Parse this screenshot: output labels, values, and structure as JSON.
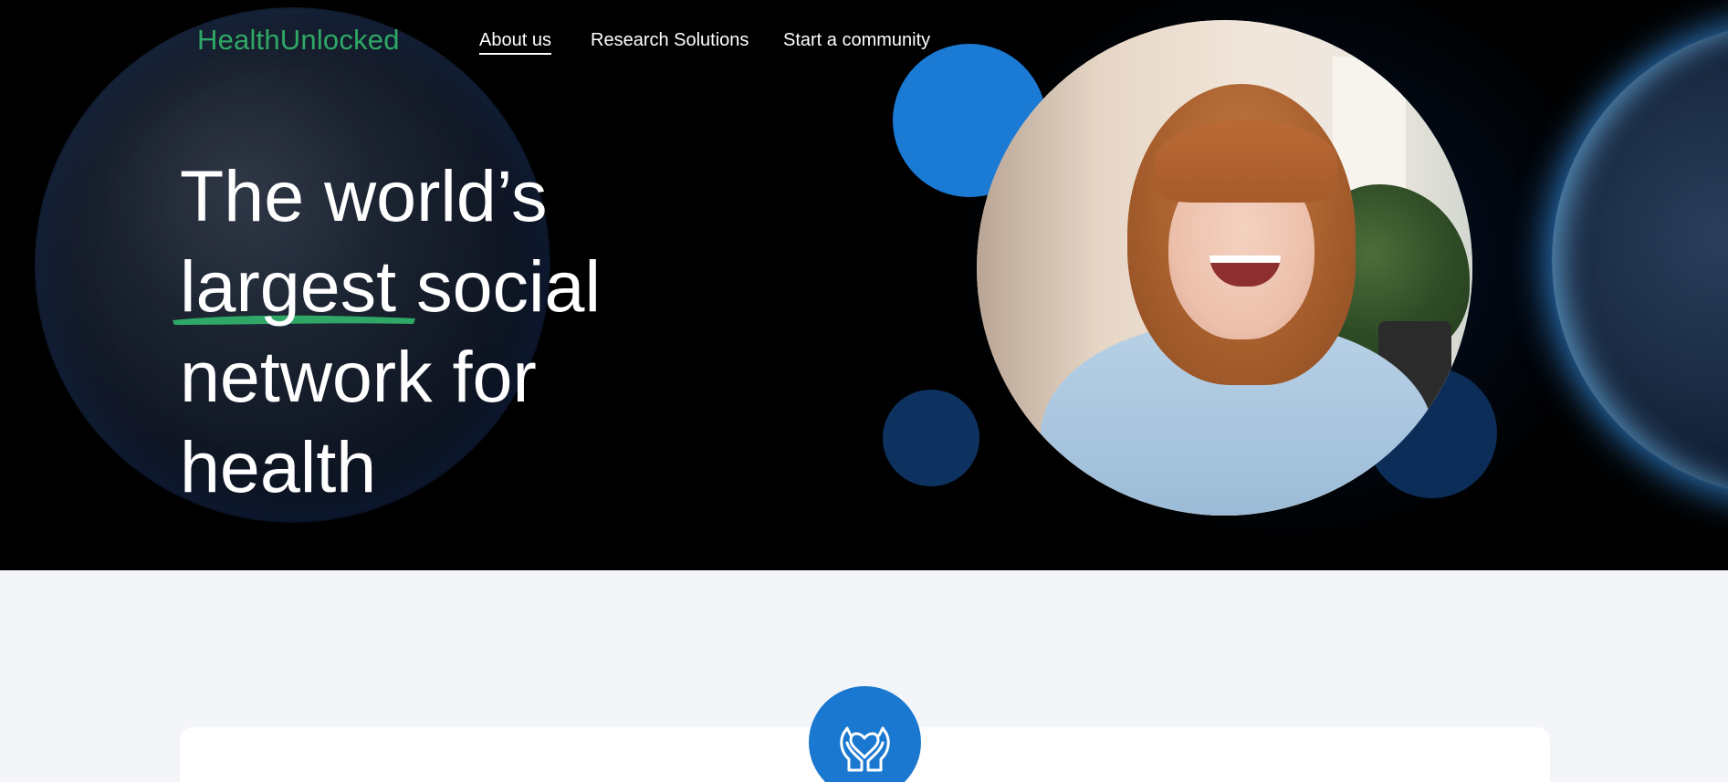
{
  "header": {
    "logo_text": "HealthUnlocked",
    "nav": [
      {
        "label": "About us",
        "active": true
      },
      {
        "label": "Research Solutions",
        "active": false
      },
      {
        "label": "Start a community",
        "active": false
      }
    ]
  },
  "hero": {
    "headline_line1": "The world’s",
    "headline_highlight": "largest",
    "headline_line2_rest": " social",
    "headline_line3": "network for",
    "headline_line4": "health"
  },
  "icons": {
    "hands_heart": "hands-holding-heart-icon"
  },
  "colors": {
    "brand_green": "#2fa866",
    "accent_blue": "#1b78d0",
    "hero_background": "#000000",
    "page_background": "#f3f5f9"
  }
}
